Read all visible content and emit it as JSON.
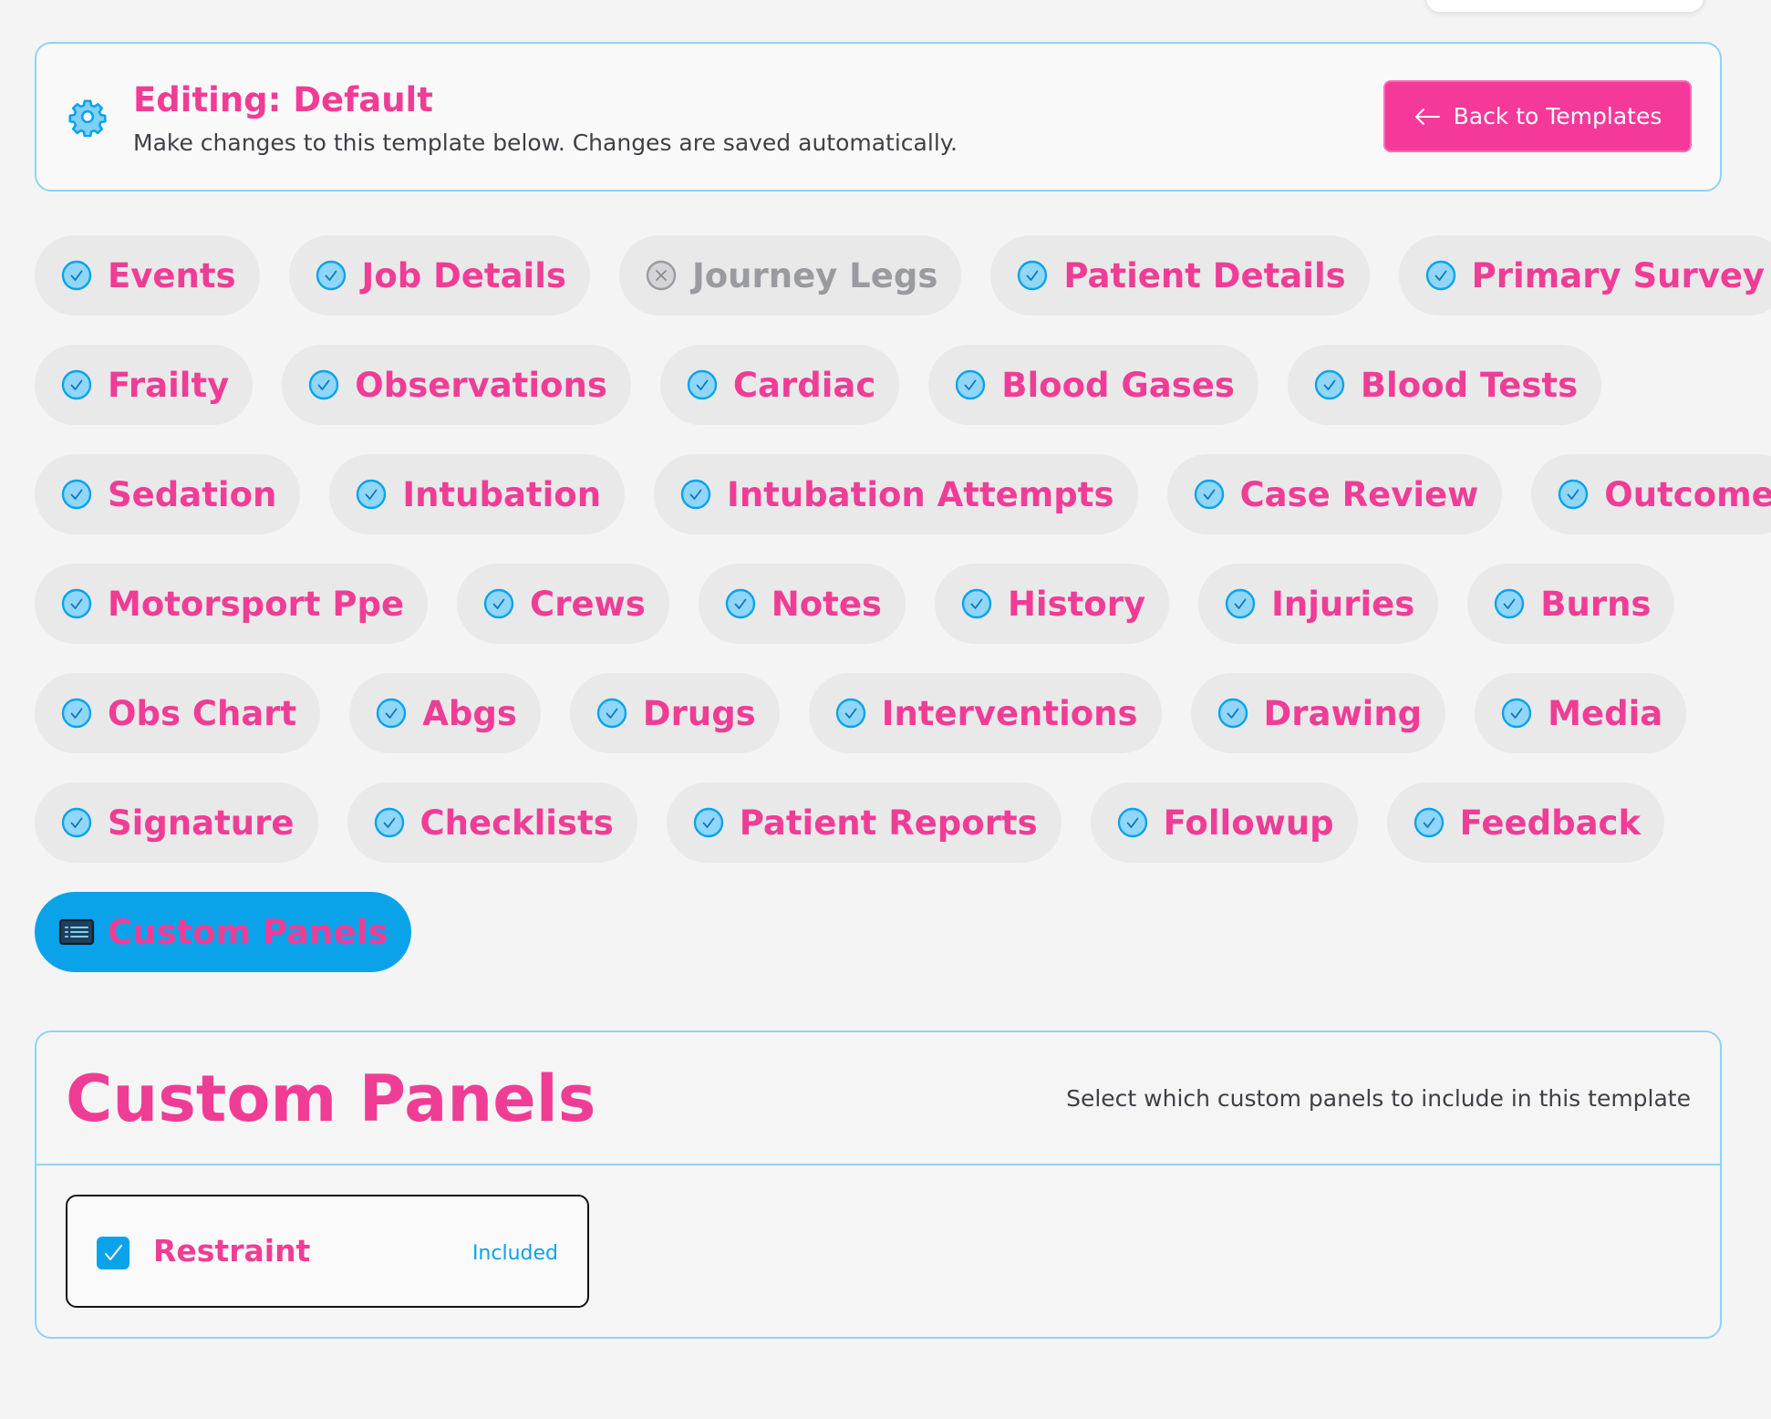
{
  "header": {
    "title": "Editing: Default",
    "subtitle": "Make changes to this template below. Changes are saved automatically.",
    "back_button_label": "Back to Templates"
  },
  "colors": {
    "accent_pink": "#ef3d96",
    "accent_blue": "#0aa3ea",
    "excluded_gray": "#9a9aa1"
  },
  "section_rows": [
    [
      {
        "label": "Events",
        "included": true
      },
      {
        "label": "Job Details",
        "included": true
      },
      {
        "label": "Journey Legs",
        "included": false
      },
      {
        "label": "Patient Details",
        "included": true
      },
      {
        "label": "Primary Survey",
        "included": true
      }
    ],
    [
      {
        "label": "Frailty",
        "included": true
      },
      {
        "label": "Observations",
        "included": true
      },
      {
        "label": "Cardiac",
        "included": true
      },
      {
        "label": "Blood Gases",
        "included": true
      },
      {
        "label": "Blood Tests",
        "included": true
      }
    ],
    [
      {
        "label": "Sedation",
        "included": true
      },
      {
        "label": "Intubation",
        "included": true
      },
      {
        "label": "Intubation Attempts",
        "included": true
      },
      {
        "label": "Case Review",
        "included": true
      },
      {
        "label": "Outcome",
        "included": true
      }
    ],
    [
      {
        "label": "Motorsport Ppe",
        "included": true
      },
      {
        "label": "Crews",
        "included": true
      },
      {
        "label": "Notes",
        "included": true
      },
      {
        "label": "History",
        "included": true
      },
      {
        "label": "Injuries",
        "included": true
      },
      {
        "label": "Burns",
        "included": true
      }
    ],
    [
      {
        "label": "Obs Chart",
        "included": true
      },
      {
        "label": "Abgs",
        "included": true
      },
      {
        "label": "Drugs",
        "included": true
      },
      {
        "label": "Interventions",
        "included": true
      },
      {
        "label": "Drawing",
        "included": true
      },
      {
        "label": "Media",
        "included": true
      }
    ],
    [
      {
        "label": "Signature",
        "included": true
      },
      {
        "label": "Checklists",
        "included": true
      },
      {
        "label": "Patient Reports",
        "included": true
      },
      {
        "label": "Followup",
        "included": true
      },
      {
        "label": "Feedback",
        "included": true
      }
    ]
  ],
  "active_tab": {
    "label": "Custom Panels",
    "icon": "list-panel-icon"
  },
  "custom_panels": {
    "title": "Custom Panels",
    "description": "Select which custom panels to include in this template",
    "options": [
      {
        "label": "Restraint",
        "checked": true,
        "status": "Included"
      }
    ]
  }
}
